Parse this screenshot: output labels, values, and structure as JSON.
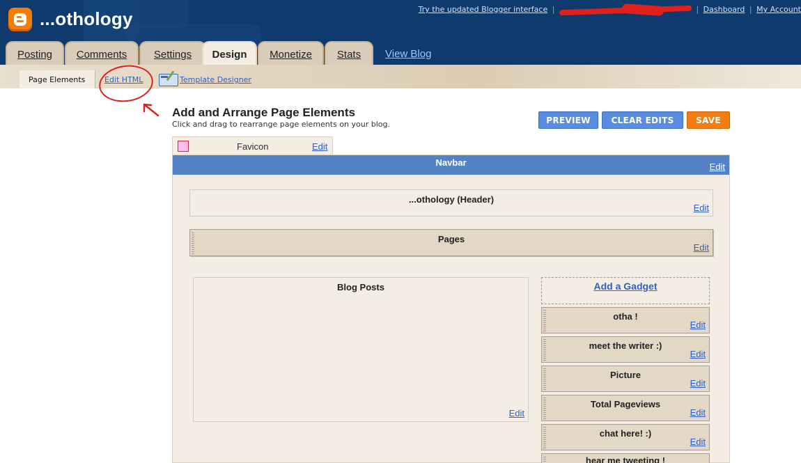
{
  "header": {
    "blog_title": "...othology",
    "links": {
      "try_updated": "Try the updated Blogger interface",
      "dashboard": "Dashboard",
      "my_account": "My Account"
    }
  },
  "tabs": [
    {
      "label": "Posting"
    },
    {
      "label": "Comments"
    },
    {
      "label": "Settings"
    },
    {
      "label": "Design",
      "active": true
    },
    {
      "label": "Monetize"
    },
    {
      "label": "Stats"
    }
  ],
  "view_blog": "View Blog",
  "subnav": {
    "page_elements": "Page Elements",
    "edit_html": "Edit HTML",
    "template_designer": "Template Designer"
  },
  "main": {
    "title": "Add and Arrange Page Elements",
    "subtitle": "Click and drag to rearrange page elements on your blog.",
    "buttons": {
      "preview": "PREVIEW",
      "clear_edits": "CLEAR EDITS",
      "save": "SAVE"
    }
  },
  "edit_label": "Edit",
  "favicon": {
    "label": "Favicon"
  },
  "navbar": {
    "label": "Navbar"
  },
  "header_gadget": {
    "label": "...othology (Header)"
  },
  "pages_gadget": {
    "label": "Pages"
  },
  "blog_posts": {
    "label": "Blog Posts"
  },
  "sidebar": {
    "add_gadget": "Add a Gadget",
    "gadgets": [
      "otha !",
      "meet the writer :)",
      "Picture",
      "Total Pageviews",
      "chat here! :)",
      "hear me tweeting !"
    ]
  },
  "colors": {
    "header_bg": "#0e3a6e",
    "navbar_bg": "#5582c4",
    "save_bg": "#f37d12",
    "button_blue": "#5a8de0",
    "annotation_red": "#e0201b"
  }
}
